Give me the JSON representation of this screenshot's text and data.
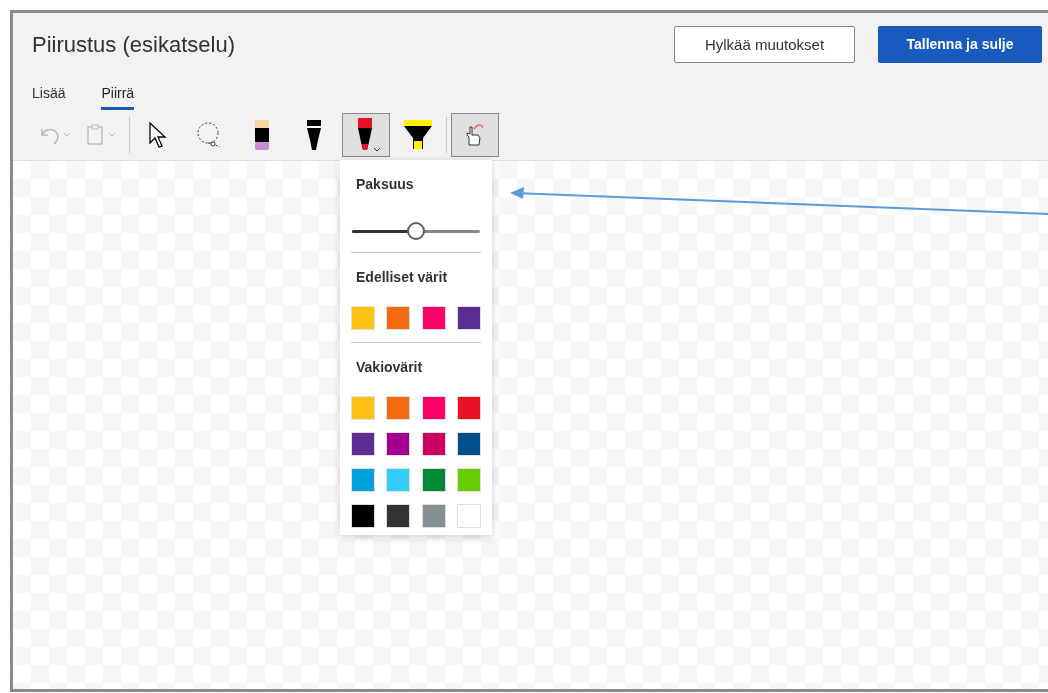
{
  "window": {
    "title": "Piirustus (esikatselu)"
  },
  "buttons": [
    {
      "label": "Hylkää muutokset",
      "kind": "secondary"
    },
    {
      "label": "Tallenna ja sulje",
      "kind": "primary"
    }
  ],
  "tabs": [
    {
      "label": "Lisää",
      "selected": false
    },
    {
      "label": "Piirrä",
      "selected": true
    }
  ],
  "toolbar": [
    {
      "kind": "undo",
      "disabled": true
    },
    {
      "kind": "paste",
      "disabled": true
    },
    {
      "kind": "separator"
    },
    {
      "kind": "select",
      "selected": false
    },
    {
      "kind": "lasso",
      "selected": false
    },
    {
      "kind": "eraser",
      "selected": false
    },
    {
      "kind": "pen",
      "selected": false
    },
    {
      "kind": "redpen",
      "selected": true
    },
    {
      "kind": "highlighter",
      "selected": false
    },
    {
      "kind": "separator"
    },
    {
      "kind": "touch",
      "selected": true
    }
  ],
  "popup": {
    "thickness_label": "Paksuus",
    "thickness": {
      "level": 0.5
    },
    "recent_label": "Edelliset värit",
    "recent_colors": [
      {
        "color": "#ffc114"
      },
      {
        "color": "#f66a0f"
      },
      {
        "color": "#ff0066"
      },
      {
        "color": "#5c2d91"
      }
    ],
    "standard_label": "Vakiovärit",
    "standard_colors": [
      {
        "color": "#ffc114"
      },
      {
        "color": "#f66a0f"
      },
      {
        "color": "#ff0066"
      },
      {
        "color": "#e81224"
      },
      {
        "color": "#5c2d91"
      },
      {
        "color": "#a4008f"
      },
      {
        "color": "#cc0063"
      },
      {
        "color": "#004e8c"
      },
      {
        "color": "#00a0d8"
      },
      {
        "color": "#33ccff"
      },
      {
        "color": "#008a38"
      },
      {
        "color": "#66cc00"
      },
      {
        "color": "#000000"
      },
      {
        "color": "#333333"
      },
      {
        "color": "#848f94"
      },
      {
        "color": "#ffffff"
      }
    ]
  }
}
